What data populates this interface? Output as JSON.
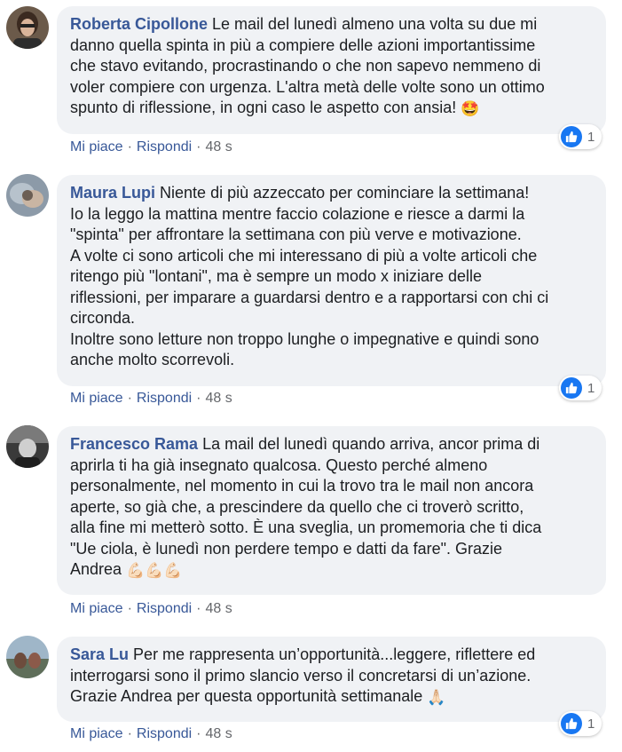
{
  "comments": [
    {
      "author": "Roberta Cipollone",
      "text_lines": [
        "Le mail del lunedì almeno una volta su due mi",
        "danno quella spinta in più a compiere delle azioni importantissime",
        "che stavo evitando, procrastinando o che non sapevo nemmeno di",
        "voler compiere con urgenza. L'altra metà delle volte sono un ottimo",
        "spunto di riflessione, in ogni caso le aspetto con ansia!"
      ],
      "emoji": "🤩",
      "like_label": "Mi piace",
      "reply_label": "Rispondi",
      "time": "48 s",
      "reaction_count": "1"
    },
    {
      "author": "Maura Lupi",
      "text_lines": [
        "Niente di più azzeccato per cominciare la settimana!",
        "Io la leggo la mattina mentre faccio colazione e riesce a darmi la",
        "\"spinta\" per affrontare la settimana con più verve e motivazione.",
        "A volte ci sono articoli che mi interessano di più a volte articoli che",
        "ritengo più \"lontani\", ma è sempre un modo x iniziare delle",
        "riflessioni, per imparare a guardarsi dentro e a rapportarsi con chi ci",
        "circonda.",
        "Inoltre sono letture non troppo lunghe o impegnative e quindi sono",
        "anche molto scorrevoli."
      ],
      "like_label": "Mi piace",
      "reply_label": "Rispondi",
      "time": "48 s",
      "reaction_count": "1"
    },
    {
      "author": "Francesco Rama",
      "text_lines": [
        "La mail del lunedì quando arriva, ancor prima di",
        "aprirla ti ha già insegnato qualcosa. Questo perché almeno",
        "personalmente, nel momento in cui la trovo tra le mail non ancora",
        "aperte, so già che, a prescindere da quello che ci troverò scritto,",
        "alla fine mi metterò sotto. È una sveglia, un promemoria che ti dica",
        "\"Ue ciola, è lunedì non perdere tempo e datti da fare\". Grazie",
        "Andrea"
      ],
      "emoji": "💪🏻💪🏻💪🏻",
      "like_label": "Mi piace",
      "reply_label": "Rispondi",
      "time": "48 s"
    },
    {
      "author": "Sara Lu",
      "text_lines": [
        "Per me rappresenta un’opportunità...leggere, riflettere ed",
        "interrogarsi sono il primo slancio verso il concretarsi di un’azione.",
        "Grazie Andrea per questa opportunità settimanale"
      ],
      "emoji": "🙏🏻",
      "like_label": "Mi piace",
      "reply_label": "Rispondi",
      "time": "48 s",
      "reaction_count": "1"
    }
  ],
  "colors": {
    "author": "#385898",
    "bubble": "#f0f2f5",
    "like_badge": "#1877f2",
    "meta": "#65676b"
  }
}
